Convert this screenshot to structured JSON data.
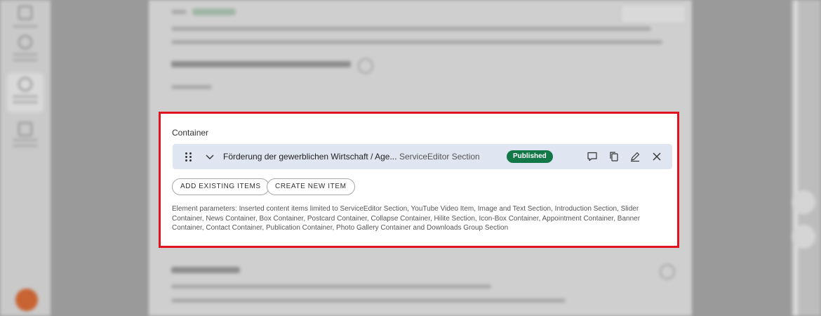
{
  "container": {
    "title": "Container",
    "item": {
      "title": "Förderung der gewerblichen Wirtschaft / Age...",
      "type": "ServiceEditor Section",
      "status": "Published"
    },
    "buttons": {
      "add_existing": "ADD EXISTING ITEMS",
      "create_new": "CREATE NEW ITEM"
    },
    "element_parameters": "Element parameters: Inserted content items limited to ServiceEditor Section, YouTube Video Item, Image and Text Section, Introduction Section, Slider Container, News Container, Box Container, Postcard Container, Collapse Container, Hilite Section, Icon-Box Container, Appointment Container, Banner Container, Contact Container, Publication Container, Photo Gallery Container and Downloads Group Section"
  },
  "colors": {
    "highlight_border": "#e0141e",
    "published_badge": "#127848",
    "item_row_bg": "#dfe6f1"
  },
  "icons": [
    "drag-handle-icon",
    "chevron-down-icon",
    "comment-icon",
    "copy-icon",
    "edit-icon",
    "close-icon"
  ]
}
